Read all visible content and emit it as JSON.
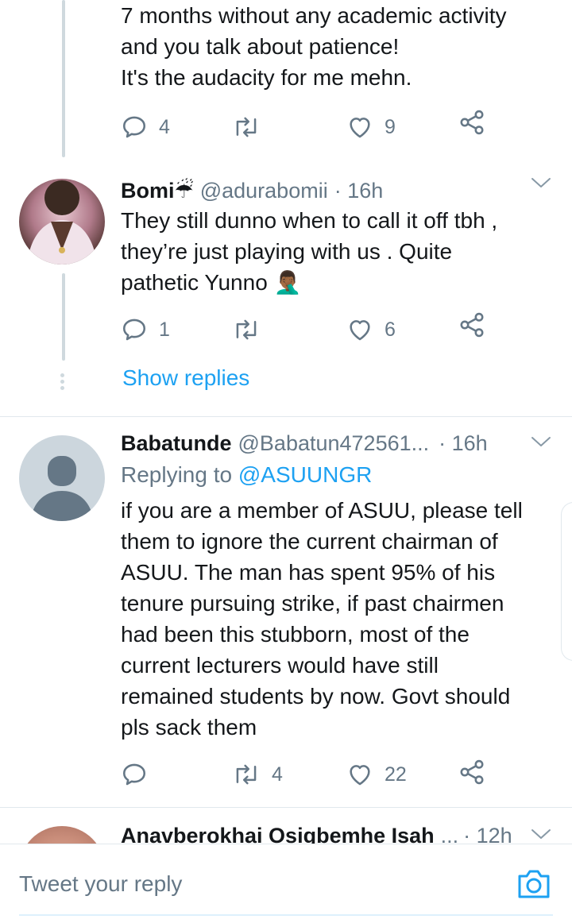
{
  "tweets": [
    {
      "text": "7 months without any academic activity\nand you talk about patience!\nIt's the audacity for me mehn.",
      "reply_count": "4",
      "retweet_count": "",
      "like_count": "9"
    },
    {
      "name": "Bomi☔",
      "handle": "@adurabomii",
      "time": "· 16h",
      "text": "They still dunno when to call it off tbh ,\nthey’re just playing with us . Quite\npathetic Yunno 🤦🏾‍♂️",
      "reply_count": "1",
      "retweet_count": "",
      "like_count": "6",
      "show_replies": "Show replies"
    },
    {
      "name": "Babatunde",
      "handle": "@Babatun472561...",
      "time": "· 16h",
      "replying_prefix": "Replying to ",
      "replying_mention": "@ASUUNGR",
      "text": "if you are a member of ASUU, please tell\nthem to ignore the current chairman of\nASUU. The man has spent 95% of his\ntenure pursuing strike, if past chairmen\nhad been this stubborn, most of the\ncurrent lecturers would have still\nremained students by now. Govt should\npls sack them",
      "reply_count": "",
      "retweet_count": "4",
      "like_count": "22"
    },
    {
      "name": "Anavberokhai Osigbemhe Isah",
      "handle": "...",
      "time": "· 12h"
    }
  ],
  "reply_bar": {
    "placeholder": "Tweet your reply"
  },
  "icons": {
    "reply": "reply-icon",
    "retweet": "retweet-icon",
    "like": "heart-icon",
    "share": "share-icon",
    "more": "chevron-down-icon",
    "camera": "camera-icon"
  },
  "colors": {
    "accent": "#1da1f2",
    "secondary_text": "#657786",
    "thread_line": "#cfd9de"
  }
}
